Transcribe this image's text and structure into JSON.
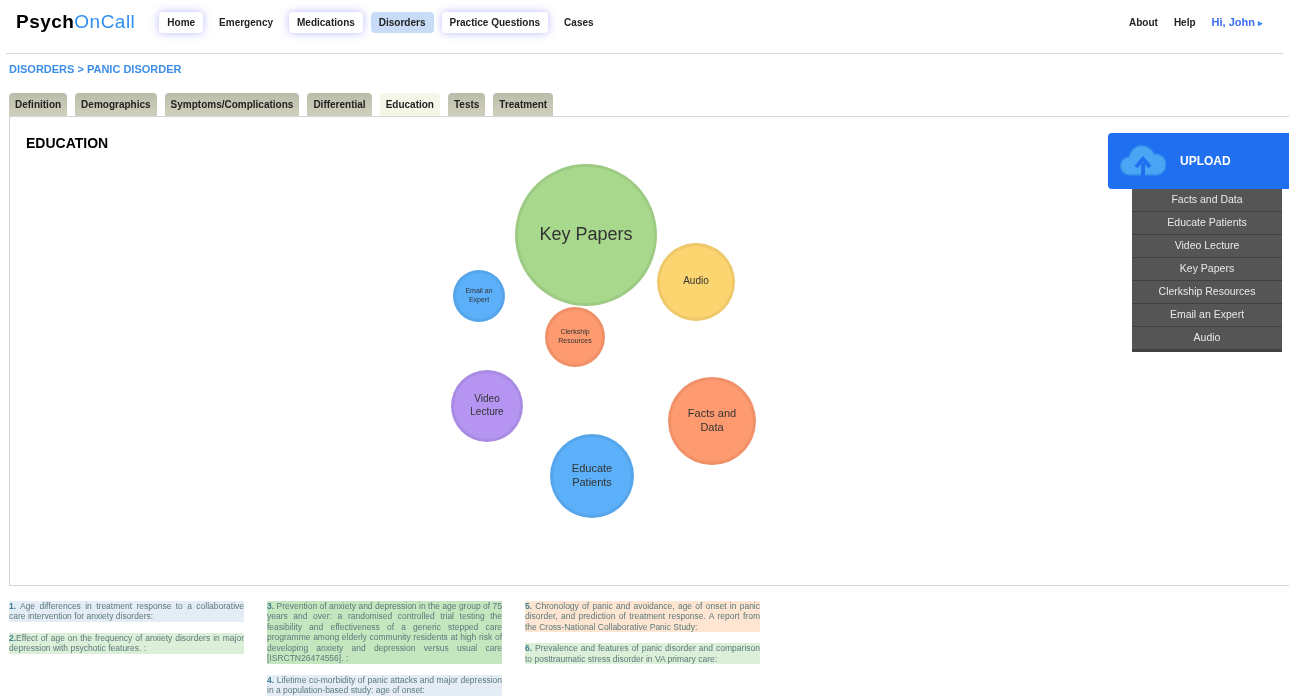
{
  "logo": {
    "part_1": "Psych",
    "part_2": "OnCall"
  },
  "nav": [
    {
      "label": "Home",
      "selected": false,
      "highlighted": true
    },
    {
      "label": "Emergency",
      "selected": false,
      "highlighted": false
    },
    {
      "label": "Medications",
      "selected": false,
      "highlighted": true
    },
    {
      "label": "Disorders",
      "selected": true,
      "highlighted": false
    },
    {
      "label": "Practice Questions",
      "selected": false,
      "highlighted": true
    },
    {
      "label": "Cases",
      "selected": false,
      "highlighted": false
    }
  ],
  "top_links": [
    "About",
    "Help"
  ],
  "user_menu": {
    "label": "Hi, John",
    "caret": "▸"
  },
  "breadcrumb": "DISORDERS > PANIC DISORDER",
  "tabs": [
    {
      "label": "Definition",
      "selected": false
    },
    {
      "label": "Demographics",
      "selected": false
    },
    {
      "label": "Symptoms/Complications",
      "selected": false
    },
    {
      "label": "Differential",
      "selected": false
    },
    {
      "label": "Education",
      "selected": true
    },
    {
      "label": "Tests",
      "selected": false
    },
    {
      "label": "Treatment",
      "selected": false
    }
  ],
  "section_title": "EDUCATION",
  "bubbles": [
    {
      "label": "Key Papers",
      "color": "#a8d88c"
    },
    {
      "label": "Audio",
      "color": "#fdd570"
    },
    {
      "label": "Email an Expert",
      "color": "#5cb0fa"
    },
    {
      "label": "Clerkship Resources",
      "color": "#fe9a70"
    },
    {
      "label": "Video Lecture",
      "color": "#b594f2"
    },
    {
      "label": "Facts and Data",
      "color": "#fe9a70"
    },
    {
      "label": "Educate Patients",
      "color": "#5cb0fa"
    }
  ],
  "upload": {
    "label": "UPLOAD",
    "items": [
      "Facts and Data",
      "Educate Patients",
      "Video Lecture",
      "Key Papers",
      "Clerkship Resources",
      "Email an Expert",
      "Audio"
    ]
  },
  "references": [
    [
      {
        "text": "**1.** Age differences in treatment response to a collaborative care intervention for anxiety disorders:",
        "color": "#e4ecf6"
      },
      {
        "text": "**2.**Effect of age on the frequency of anxiety disorders in major depression with psychotic features. :",
        "color": "#dcefd8"
      }
    ],
    [
      {
        "text": "**3.** Prevention of anxiety and depression in the age group of 75 years and over: a randomised controlled trial testing the feasibility and effectiveness of a generic stepped care programme among elderly community residents at high risk of developing anxiety and depression versus usual care [ISRCTN26474556]. :",
        "color": "#c6e6c0"
      },
      {
        "text": "**4.** Lifetime co-morbidity of panic attacks and major depression in a population-based study: age of onset:",
        "color": "#e4ecf6"
      }
    ],
    [
      {
        "text": "**5.** Chronology of panic and avoidance, age of onset in panic disorder, and prediction of treatment response. A report from the Cross-National Collaborative Panic Study:",
        "color": "#fde5d2"
      },
      {
        "text": "**6.** Prevalence and features of panic disorder and comparison to posttraumatic stress disorder in VA primary care:",
        "color": "#dcefd8"
      }
    ]
  ]
}
